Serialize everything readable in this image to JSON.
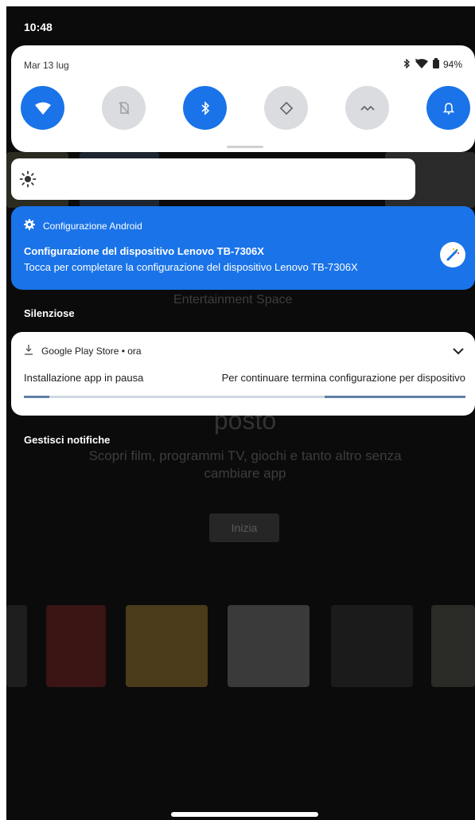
{
  "status_bar": {
    "time": "10:48"
  },
  "quick_settings": {
    "date": "Mar 13 lug",
    "battery": "94%",
    "tiles": [
      {
        "icon": "wifi-icon",
        "active": true
      },
      {
        "icon": "no-sim-icon",
        "active": false
      },
      {
        "icon": "bluetooth-icon",
        "active": true
      },
      {
        "icon": "auto-rotate-icon",
        "active": false
      },
      {
        "icon": "data-saver-icon",
        "active": false
      },
      {
        "icon": "bell-icon",
        "active": true
      }
    ]
  },
  "brightness": {
    "icon": "brightness-icon",
    "level": 1.0
  },
  "notification_android": {
    "app": "Configurazione Android",
    "title": "Configurazione del dispositivo Lenovo TB-7306X",
    "text": "Tocca per completare la configurazione del dispositivo Lenovo TB-7306X",
    "action_icon": "magic-wand-icon"
  },
  "sections": {
    "silent": "Silenziose",
    "manage": "Gestisci notifiche"
  },
  "notification_play": {
    "app": "Google Play Store • ora",
    "title": "Installazione app in pausa",
    "text": "Per continuare termina configurazione per dispositivo"
  },
  "background": {
    "entertainment_space": "Entertainment Space",
    "heading": "posto",
    "subtitle_1": "Scopri film, programmi TV, giochi e tanto altro senza",
    "subtitle_2": "cambiare app",
    "start_button": "Inizia"
  },
  "colors": {
    "accent": "#1a73e8",
    "tile_off": "#dadce0",
    "scrim": "#0b0b0b"
  }
}
